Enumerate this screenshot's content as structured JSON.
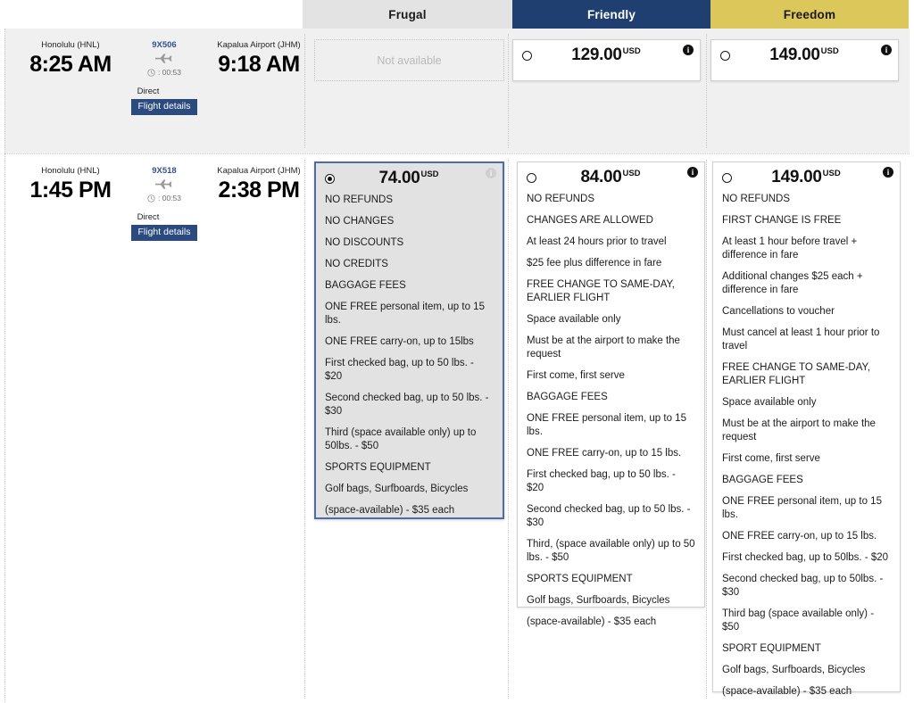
{
  "fare_tabs": [
    {
      "key": "frugal",
      "label": "Frugal",
      "bg": "#e3e3e3",
      "fg": "#1a1a1a"
    },
    {
      "key": "friendly",
      "label": "Friendly",
      "bg": "#1e3f6f",
      "fg": "#ffffff"
    },
    {
      "key": "freedom",
      "label": "Freedom",
      "bg": "#dcc75a",
      "fg": "#1a1a1a"
    }
  ],
  "flights": [
    {
      "id": "row1",
      "departure_airport": "Honolulu (HNL)",
      "departure_time": "8:25 AM",
      "flight_number": "9X506",
      "duration": ": 00:53",
      "arrival_airport": "Kapalua Airport (JHM)",
      "arrival_time": "9:18 AM",
      "stops": "Direct",
      "details_label": "Flight details",
      "fares": {
        "frugal": {
          "available": false,
          "unavailable_label": "Not available"
        },
        "friendly": {
          "available": true,
          "selected": false,
          "price": "129.00",
          "currency": "USD",
          "rules": []
        },
        "freedom": {
          "available": true,
          "selected": false,
          "price": "149.00",
          "currency": "USD",
          "rules": []
        }
      }
    },
    {
      "id": "row2",
      "departure_airport": "Honolulu (HNL)",
      "departure_time": "1:45 PM",
      "flight_number": "9X518",
      "duration": ": 00:53",
      "arrival_airport": "Kapalua Airport (JHM)",
      "arrival_time": "2:38 PM",
      "stops": "Direct",
      "details_label": "Flight details",
      "fares": {
        "frugal": {
          "available": true,
          "selected": true,
          "price": "74.00",
          "currency": "USD",
          "rules": [
            "NO REFUNDS",
            "NO CHANGES",
            "NO DISCOUNTS",
            "NO CREDITS",
            "BAGGAGE FEES",
            "ONE FREE personal item, up to 15 lbs.",
            "ONE FREE carry-on, up to 15lbs",
            "First checked bag, up to 50 lbs. - $20",
            "Second checked bag, up to 50 lbs. - $30",
            "Third (space available only) up to 50lbs. - $50",
            "SPORTS EQUIPMENT",
            "Golf bags, Surfboards, Bicycles",
            "(space-available) - $35 each"
          ]
        },
        "friendly": {
          "available": true,
          "selected": false,
          "price": "84.00",
          "currency": "USD",
          "rules": [
            "NO REFUNDS",
            "CHANGES ARE ALLOWED",
            "At least 24 hours prior to travel",
            "$25 fee plus difference in fare",
            "FREE CHANGE TO SAME-DAY, EARLIER FLIGHT",
            "Space available only",
            "Must be at the airport to make the request",
            "First come, first serve",
            "BAGGAGE FEES",
            "ONE FREE personal item, up to 15 lbs.",
            "ONE FREE carry-on, up to 15 lbs.",
            "First checked bag, up to 50 lbs. - $20",
            "Second checked bag, up to 50 lbs. - $30",
            "Third, (space available only) up to 50 lbs. - $50",
            "SPORTS EQUIPMENT",
            "Golf bags, Surfboards, Bicycles",
            "(space-available) - $35 each"
          ]
        },
        "freedom": {
          "available": true,
          "selected": false,
          "price": "149.00",
          "currency": "USD",
          "rules": [
            "NO REFUNDS",
            "FIRST CHANGE IS FREE",
            "At least 1 hour before travel + difference in fare",
            "Additional changes $25 each + difference in fare",
            "Cancellations to voucher",
            "Must cancel at least 1 hour prior to travel",
            "FREE CHANGE TO SAME-DAY, EARLIER FLIGHT",
            "Space available only",
            "Must be at the airport to make the request",
            "First come, first serve",
            "BAGGAGE FEES",
            "ONE FREE personal item, up to 15 lbs.",
            "ONE FREE carry-on, up to 15 lbs.",
            "First checked bag, up to 50lbs. - $20",
            "Second checked bag, up to 50lbs. - $30",
            "Third bag (space available only) - $50",
            "SPORT EQUIPMENT",
            "Golf bags, Surfboards, Bicycles",
            "(space-available) - $35 each"
          ]
        }
      }
    }
  ],
  "icons": {
    "plane": "plane-icon",
    "clock": "clock-icon",
    "info": "info-icon"
  },
  "colors": {
    "frugal_tab": "#e3e3e3",
    "friendly_tab": "#1e3f6f",
    "freedom_tab": "#dcc75a",
    "flight_number": "#33508c",
    "details_button": "#2a4a80",
    "selected_card_border": "#4f6d9e"
  }
}
